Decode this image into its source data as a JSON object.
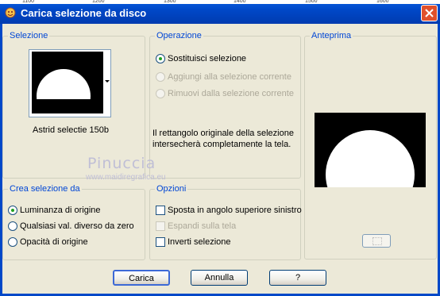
{
  "window": {
    "title": "Carica selezione da disco"
  },
  "ruler_labels": [
    "1100",
    "1200",
    "1300",
    "1400",
    "1500",
    "1600"
  ],
  "selezione": {
    "legend": "Selezione",
    "selection_name": "Astrid selectie 150b"
  },
  "operazione": {
    "legend": "Operazione",
    "options": [
      "Sostituisci selezione",
      "Aggiungi alla selezione corrente",
      "Rimuovi dalla selezione corrente"
    ],
    "selected": 0,
    "description_line1": "Il rettangolo originale della selezione",
    "description_line2": "intersecherà completamente la tela."
  },
  "anteprima": {
    "legend": "Anteprima"
  },
  "crea_selezione": {
    "legend": "Crea selezione da",
    "options": [
      "Luminanza di origine",
      "Qualsiasi val. diverso da zero",
      "Opacità di origine"
    ],
    "selected": 0
  },
  "opzioni": {
    "legend": "Opzioni",
    "items": [
      "Sposta in angolo superiore sinistro",
      "Espandi sulla tela",
      "Inverti selezione"
    ],
    "checked": [
      false,
      false,
      false
    ],
    "disabled": [
      false,
      true,
      false
    ]
  },
  "watermark": {
    "line1": "Pinuccia",
    "line2": "www.maidiregrafica.eu"
  },
  "buttons": {
    "ok": "Carica",
    "cancel": "Annulla",
    "help": "?"
  },
  "colors": {
    "titlebar": "#0048c8",
    "legend": "#0046d5",
    "dialog_bg": "#ece9d8",
    "close": "#e0502c"
  }
}
